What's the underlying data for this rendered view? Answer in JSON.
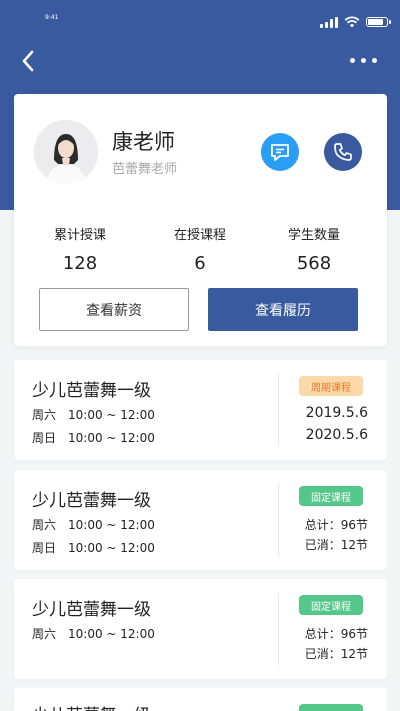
{
  "status_bar": {
    "time": "9:41"
  },
  "nav": {
    "back_icon": "chevron-left-icon",
    "more_icon": "more-dots-icon"
  },
  "colors": {
    "primary": "#3a5aa0",
    "chat": "#2a9df4",
    "tag_orange_bg": "#fcd9a8",
    "tag_orange_text": "#e87b2b",
    "tag_green": "#56c78b"
  },
  "profile": {
    "name": "康老师",
    "subtitle": "芭蕾舞老师",
    "chat_icon": "chat-bubble-icon",
    "phone_icon": "phone-icon"
  },
  "stats": [
    {
      "label": "累计授课",
      "value": "128"
    },
    {
      "label": "在授课程",
      "value": "6"
    },
    {
      "label": "学生数量",
      "value": "568"
    }
  ],
  "actions": {
    "salary": "查看薪资",
    "resume": "查看履历"
  },
  "courses": [
    {
      "title": "少儿芭蕾舞一级",
      "schedule": [
        {
          "day": "周六",
          "time": "10:00 ~ 12:00"
        },
        {
          "day": "周日",
          "time": "10:00 ~ 12:00"
        }
      ],
      "tag": "周期课程",
      "right": [
        "2019.5.6",
        "2020.5.6"
      ]
    },
    {
      "title": "少儿芭蕾舞一级",
      "schedule": [
        {
          "day": "周六",
          "time": "10:00 ~ 12:00"
        },
        {
          "day": "周日",
          "time": "10:00 ~ 12:00"
        }
      ],
      "tag": "固定课程",
      "right": [
        "总计：96节",
        "已消：12节"
      ]
    },
    {
      "title": "少儿芭蕾舞一级",
      "schedule": [
        {
          "day": "周六",
          "time": "10:00 ~ 12:00"
        }
      ],
      "tag": "固定课程",
      "right": [
        "总计：96节",
        "已消：12节"
      ]
    },
    {
      "title": "少儿芭蕾舞一级",
      "schedule": [],
      "tag": "",
      "right": []
    }
  ]
}
